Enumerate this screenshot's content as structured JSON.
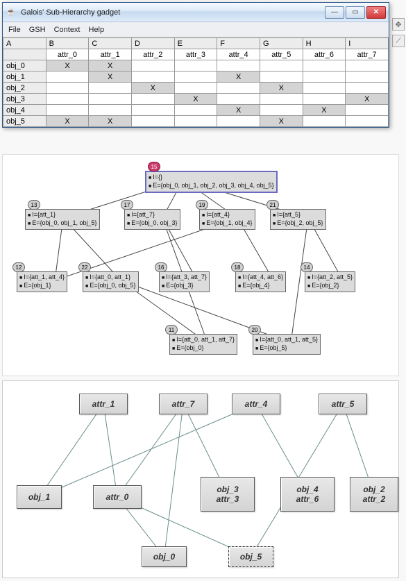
{
  "window": {
    "title": "Galois' Sub-Hierarchy gadget",
    "menus": [
      "File",
      "GSH",
      "Context",
      "Help"
    ],
    "btn_min_glyph": "—",
    "btn_max_glyph": "▭",
    "btn_close_glyph": "✕",
    "java_glyph": "☕"
  },
  "table": {
    "col_letters": [
      "A",
      "B",
      "C",
      "D",
      "E",
      "F",
      "G",
      "H",
      "I"
    ],
    "attr_headers": [
      "",
      "attr_0",
      "attr_1",
      "attr_2",
      "attr_3",
      "attr_4",
      "attr_5",
      "attr_6",
      "attr_7"
    ],
    "rows": [
      {
        "label": "obj_0",
        "marks": [
          false,
          true,
          true,
          false,
          false,
          false,
          false,
          false,
          false
        ]
      },
      {
        "label": "obj_1",
        "marks": [
          false,
          false,
          true,
          false,
          false,
          true,
          false,
          false,
          false
        ]
      },
      {
        "label": "obj_2",
        "marks": [
          false,
          false,
          false,
          true,
          false,
          false,
          true,
          false,
          false
        ]
      },
      {
        "label": "obj_3",
        "marks": [
          false,
          false,
          false,
          false,
          true,
          false,
          false,
          false,
          true
        ]
      },
      {
        "label": "obj_4",
        "marks": [
          false,
          false,
          false,
          false,
          false,
          true,
          false,
          true,
          false
        ]
      },
      {
        "label": "obj_5",
        "marks": [
          false,
          true,
          true,
          false,
          false,
          false,
          true,
          false,
          false
        ]
      }
    ]
  },
  "lattice": {
    "nodes": {
      "n15": {
        "id": "15",
        "I": "I={}",
        "E": "E={obj_0, obj_1, obj_2, obj_3, obj_4, obj_5}"
      },
      "n13": {
        "id": "13",
        "I": "I={att_1}",
        "E": "E={obj_0, obj_1, obj_5}"
      },
      "n17": {
        "id": "17",
        "I": "I={att_7}",
        "E": "E={obj_0, obj_3}"
      },
      "n19": {
        "id": "19",
        "I": "I={att_4}",
        "E": "E={obj_1, obj_4}"
      },
      "n21": {
        "id": "21",
        "I": "I={att_5}",
        "E": "E={obj_2, obj_5}"
      },
      "n12": {
        "id": "12",
        "I": "I={att_1, att_4}",
        "E": "E={obj_1}"
      },
      "n22": {
        "id": "22",
        "I": "I={att_0, att_1}",
        "E": "E={obj_0, obj_5}"
      },
      "n16": {
        "id": "16",
        "I": "I={att_3, att_7}",
        "E": "E={obj_3}"
      },
      "n18": {
        "id": "18",
        "I": "I={att_4, att_6}",
        "E": "E={obj_4}"
      },
      "n14": {
        "id": "14",
        "I": "I={att_2, att_5}",
        "E": "E={obj_2}"
      },
      "n11": {
        "id": "11",
        "I": "I={att_0, att_1, att_7}",
        "E": "E={obj_0}"
      },
      "n20": {
        "id": "20",
        "I": "I={att_0, att_1, att_5}",
        "E": "E={obj_5}"
      }
    }
  },
  "bigraph": {
    "nodes": {
      "attr_1": "attr_1",
      "attr_7": "attr_7",
      "attr_4": "attr_4",
      "attr_5": "attr_5",
      "attr_0": "attr_0",
      "attr_3": "attr_3",
      "attr_6": "attr_6",
      "attr_2": "attr_2",
      "obj_0": "obj_0",
      "obj_1": "obj_1",
      "obj_2": "obj_2",
      "obj_3": "obj_3",
      "obj_4": "obj_4",
      "obj_5": "obj_5"
    }
  },
  "palette": {
    "grab": "✥",
    "link": "⟋"
  }
}
